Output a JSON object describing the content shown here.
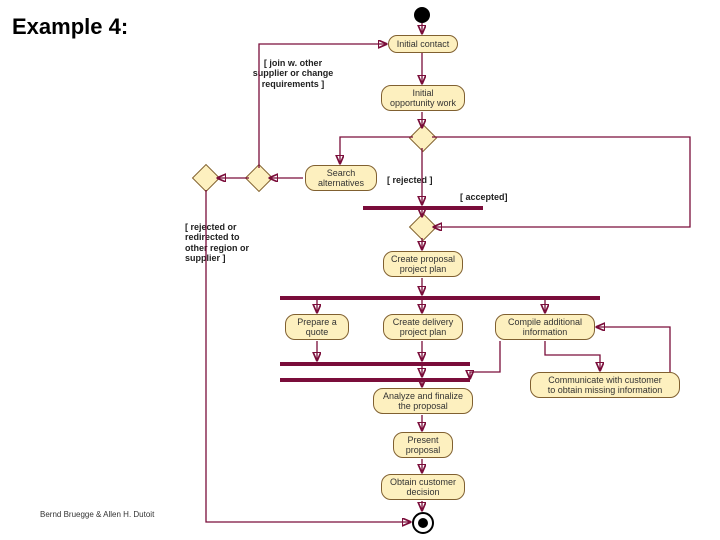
{
  "page": {
    "title": "Example 4:",
    "credit": "Bernd Bruegge & Allen H. Dutoit"
  },
  "activities": {
    "initial_contact": "Initial contact",
    "initial_opportunity_work": "Initial\nopportunity work",
    "search_alternatives": "Search\nalternatives",
    "create_proposal_plan": "Create proposal\nproject plan",
    "prepare_quote": "Prepare a\nquote",
    "create_delivery_plan": "Create delivery\nproject plan",
    "compile_additional_info": "Compile additional\ninformation",
    "communicate_missing_info": "Communicate with customer\nto obtain missing information",
    "analyze_finalize": "Analyze and finalize\nthe proposal",
    "present_proposal": "Present\nproposal",
    "obtain_decision": "Obtain customer\ndecision"
  },
  "guards": {
    "join_other_supplier": "[ join w. other\nsupplier or change\nrequirements ]",
    "rejected_redirected": "[ rejected or\nredirected to\nother region or\nsupplier ]",
    "rejected": "[ rejected ]",
    "accepted": "[ accepted]"
  },
  "diagram": {
    "type": "uml-activity-diagram",
    "initial_node": true,
    "final_node": true,
    "decision_nodes": 4,
    "sync_bars": 4
  }
}
